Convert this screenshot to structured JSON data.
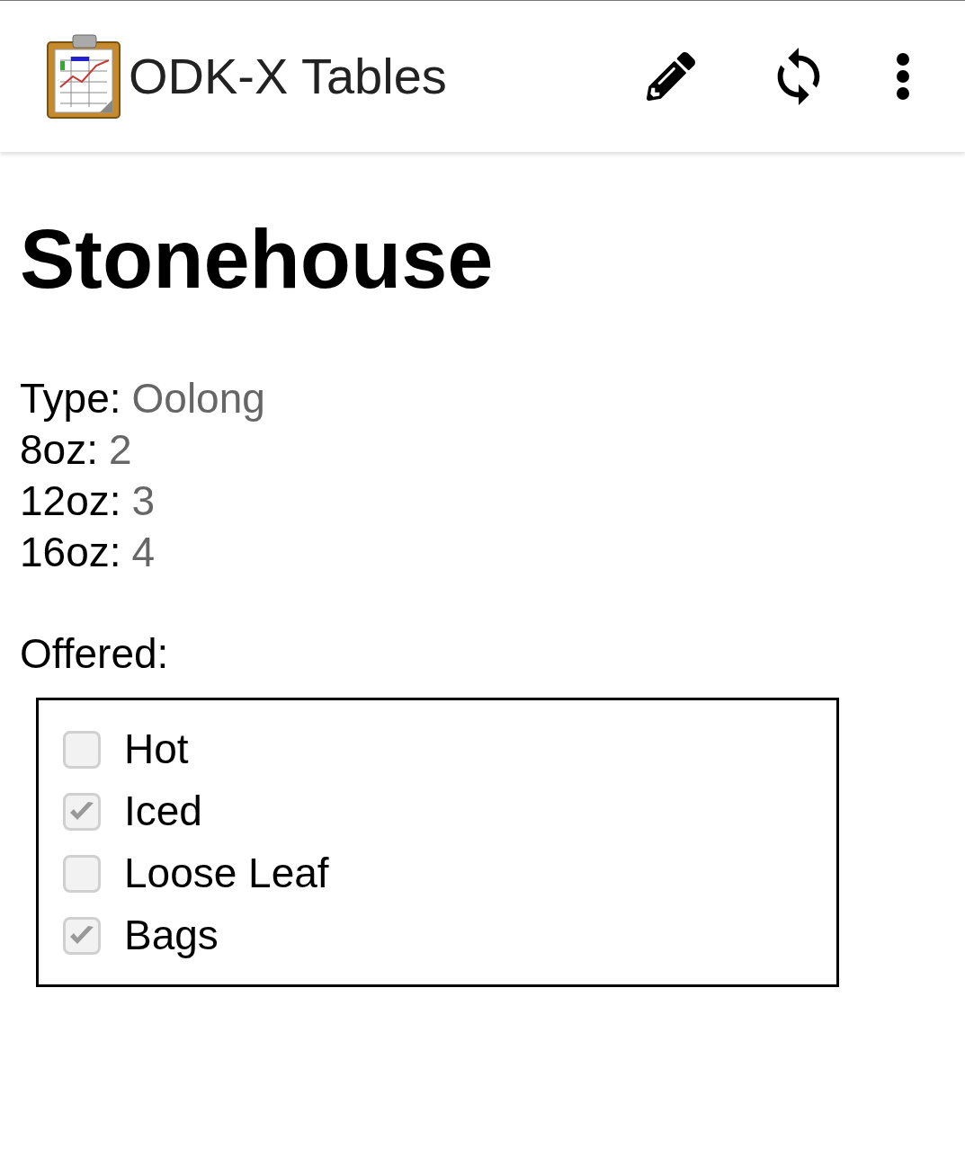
{
  "app_bar": {
    "title": "ODK-X Tables"
  },
  "record": {
    "title": "Stonehouse",
    "fields": [
      {
        "label": "Type:",
        "value": "Oolong"
      },
      {
        "label": "8oz:",
        "value": "2"
      },
      {
        "label": "12oz:",
        "value": "3"
      },
      {
        "label": "16oz:",
        "value": "4"
      }
    ],
    "offered": {
      "label": "Offered:",
      "options": [
        {
          "label": "Hot",
          "checked": false
        },
        {
          "label": "Iced",
          "checked": true
        },
        {
          "label": "Loose Leaf",
          "checked": false
        },
        {
          "label": "Bags",
          "checked": true
        }
      ]
    }
  }
}
